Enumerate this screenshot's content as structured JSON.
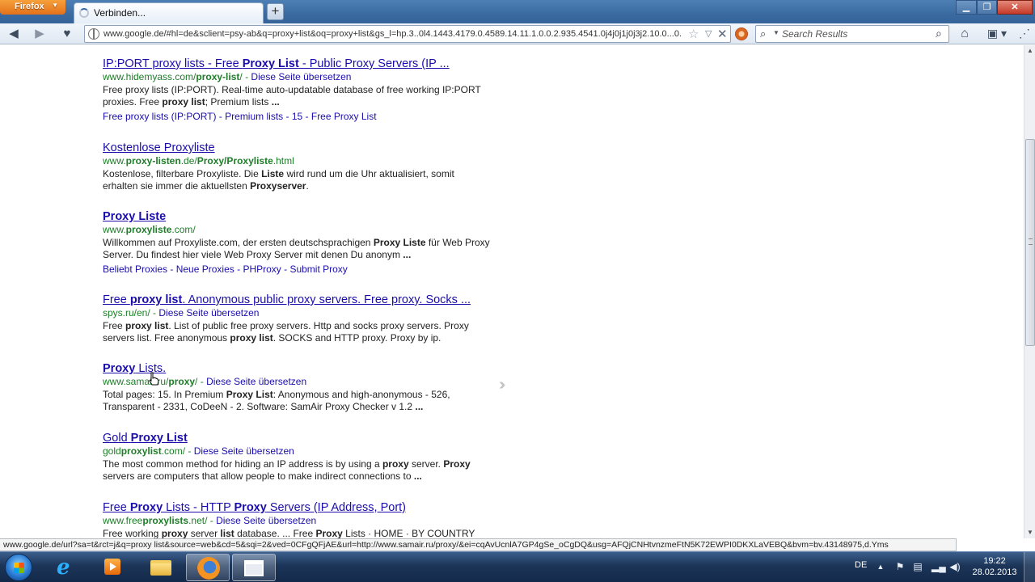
{
  "browser": {
    "menu_button": "Firefox",
    "tab_title": "Verbinden...",
    "new_tab": "+",
    "url": "www.google.de/#hl=de&sclient=psy-ab&q=proxy+list&oq=proxy+list&gs_l=hp.3..0l4.1443.4179.0.4589.14.11.1.0.0.2.935.4541.0j4j0j1j0j3j2.10.0...0.",
    "search_placeholder": "Search Results",
    "status_url": "www.google.de/url?sa=t&rct=j&q=proxy list&source=web&cd=5&sqi=2&ved=0CFgQFjAE&url=http://www.samair.ru/proxy/&ei=cqAvUcnlA7GP4gSe_oCgDQ&usg=AFQjCNHtvnzmeFtN5K72EWPI0DKXLaVEBQ&bvm=bv.43148975,d.Yms"
  },
  "results": [
    {
      "title": [
        "IP:PORT proxy lists - Free ",
        {
          "b": "Proxy List"
        },
        " - Public Proxy Servers (IP ..."
      ],
      "url": [
        "www.hidemyass.com/",
        {
          "b": "proxy-list"
        },
        "/"
      ],
      "translate": "Diese Seite übersetzen",
      "snippet": [
        "Free proxy lists (IP:PORT). Real-time auto-updatable database of free working IP:PORT proxies. Free ",
        {
          "b": "proxy list"
        },
        "; Premium lists ",
        {
          "b": "..."
        }
      ],
      "sitelinks": [
        "Free proxy lists (IP:PORT)",
        "Premium lists",
        "15",
        "Free Proxy List"
      ]
    },
    {
      "title": [
        "Kostenlose Proxyliste"
      ],
      "url": [
        "www.",
        {
          "b": "proxy-listen"
        },
        ".de/",
        {
          "b": "Proxy/Proxyliste"
        },
        ".html"
      ],
      "translate": "",
      "snippet": [
        "Kostenlose, filterbare Proxyliste. Die ",
        {
          "b": "Liste"
        },
        " wird rund um die Uhr aktualisiert, somit erhalten sie immer die aktuellsten ",
        {
          "b": "Proxyserver"
        },
        "."
      ],
      "sitelinks": []
    },
    {
      "title": [
        {
          "b": "Proxy Liste"
        }
      ],
      "url": [
        "www.",
        {
          "b": "proxyliste"
        },
        ".com/"
      ],
      "translate": "",
      "snippet": [
        "Willkommen auf Proxyliste.com, der ersten deutschsprachigen ",
        {
          "b": "Proxy Liste"
        },
        " für Web Proxy Server. Du findest hier viele Web Proxy Server mit denen Du anonym ",
        {
          "b": "..."
        }
      ],
      "sitelinks": [
        "Beliebt Proxies",
        "Neue Proxies",
        "PHProxy",
        "Submit Proxy"
      ]
    },
    {
      "title": [
        "Free ",
        {
          "b": "proxy list"
        },
        ". Anonymous public proxy servers. Free proxy. Socks ..."
      ],
      "url": [
        "spys.ru/en/"
      ],
      "translate": "Diese Seite übersetzen",
      "snippet": [
        "Free ",
        {
          "b": "proxy list"
        },
        ". List of public free proxy servers. Http and socks proxy servers. Proxy servers list. Free anonymous ",
        {
          "b": "proxy list"
        },
        ". SOCKS and HTTP proxy. Proxy by ip."
      ],
      "sitelinks": []
    },
    {
      "title": [
        {
          "b": "Proxy"
        },
        " Lists."
      ],
      "url": [
        "www.samair.ru/",
        {
          "b": "proxy"
        },
        "/"
      ],
      "translate": "Diese Seite übersetzen",
      "snippet": [
        "Total pages: 15. In Premium ",
        {
          "b": "Proxy List"
        },
        ": Anonymous and high-anonymous - 526, Transparent - 2331, CoDeeN - 2. Software: SamAir Proxy Checker v 1.2 ",
        {
          "b": "..."
        }
      ],
      "sitelinks": []
    },
    {
      "title": [
        "Gold ",
        {
          "b": "Proxy List"
        }
      ],
      "url": [
        "gold",
        {
          "b": "proxylist"
        },
        ".com/"
      ],
      "translate": "Diese Seite übersetzen",
      "snippet": [
        "The most common method for hiding an IP address is by using a ",
        {
          "b": "proxy"
        },
        " server. ",
        {
          "b": "Proxy"
        },
        " servers are computers that allow people to make indirect connections to ",
        {
          "b": "..."
        }
      ],
      "sitelinks": []
    },
    {
      "title": [
        "Free ",
        {
          "b": "Proxy"
        },
        " Lists - HTTP ",
        {
          "b": "Proxy"
        },
        " Servers (IP Address, Port)"
      ],
      "url": [
        "www.free",
        {
          "b": "proxylists"
        },
        ".net/"
      ],
      "translate": "Diese Seite übersetzen",
      "snippet": [
        "Free working ",
        {
          "b": "proxy"
        },
        " server ",
        {
          "b": "list"
        },
        " database. ... Free ",
        {
          "b": "Proxy"
        },
        " Lists · HOME · BY COUNTRY"
      ],
      "sitelinks": []
    }
  ],
  "taskbar": {
    "language": "DE",
    "time": "19:22",
    "date": "28.02.2013"
  },
  "colors": {
    "link": "#1a0dab",
    "url_green": "#1e7d28",
    "firefox_orange": "#e3711a",
    "titlebar_blue": "#3a6aa0"
  },
  "icons": {
    "back": "back-arrow-icon",
    "forward": "forward-arrow-icon",
    "home": "home-icon",
    "star": "star-icon",
    "stop": "stop-icon",
    "search": "magnifier-icon"
  }
}
